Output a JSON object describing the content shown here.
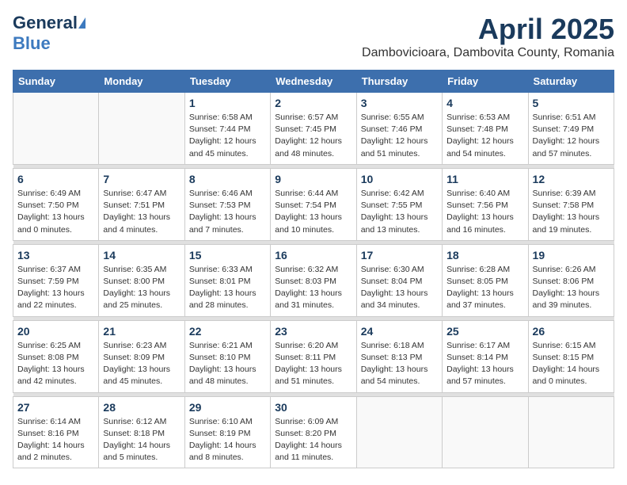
{
  "header": {
    "logo_general": "General",
    "logo_blue": "Blue",
    "month_title": "April 2025",
    "location": "Dambovicioara, Dambovita County, Romania"
  },
  "days_of_week": [
    "Sunday",
    "Monday",
    "Tuesday",
    "Wednesday",
    "Thursday",
    "Friday",
    "Saturday"
  ],
  "weeks": [
    [
      {
        "day": "",
        "detail": ""
      },
      {
        "day": "",
        "detail": ""
      },
      {
        "day": "1",
        "detail": "Sunrise: 6:58 AM\nSunset: 7:44 PM\nDaylight: 12 hours\nand 45 minutes."
      },
      {
        "day": "2",
        "detail": "Sunrise: 6:57 AM\nSunset: 7:45 PM\nDaylight: 12 hours\nand 48 minutes."
      },
      {
        "day": "3",
        "detail": "Sunrise: 6:55 AM\nSunset: 7:46 PM\nDaylight: 12 hours\nand 51 minutes."
      },
      {
        "day": "4",
        "detail": "Sunrise: 6:53 AM\nSunset: 7:48 PM\nDaylight: 12 hours\nand 54 minutes."
      },
      {
        "day": "5",
        "detail": "Sunrise: 6:51 AM\nSunset: 7:49 PM\nDaylight: 12 hours\nand 57 minutes."
      }
    ],
    [
      {
        "day": "6",
        "detail": "Sunrise: 6:49 AM\nSunset: 7:50 PM\nDaylight: 13 hours\nand 0 minutes."
      },
      {
        "day": "7",
        "detail": "Sunrise: 6:47 AM\nSunset: 7:51 PM\nDaylight: 13 hours\nand 4 minutes."
      },
      {
        "day": "8",
        "detail": "Sunrise: 6:46 AM\nSunset: 7:53 PM\nDaylight: 13 hours\nand 7 minutes."
      },
      {
        "day": "9",
        "detail": "Sunrise: 6:44 AM\nSunset: 7:54 PM\nDaylight: 13 hours\nand 10 minutes."
      },
      {
        "day": "10",
        "detail": "Sunrise: 6:42 AM\nSunset: 7:55 PM\nDaylight: 13 hours\nand 13 minutes."
      },
      {
        "day": "11",
        "detail": "Sunrise: 6:40 AM\nSunset: 7:56 PM\nDaylight: 13 hours\nand 16 minutes."
      },
      {
        "day": "12",
        "detail": "Sunrise: 6:39 AM\nSunset: 7:58 PM\nDaylight: 13 hours\nand 19 minutes."
      }
    ],
    [
      {
        "day": "13",
        "detail": "Sunrise: 6:37 AM\nSunset: 7:59 PM\nDaylight: 13 hours\nand 22 minutes."
      },
      {
        "day": "14",
        "detail": "Sunrise: 6:35 AM\nSunset: 8:00 PM\nDaylight: 13 hours\nand 25 minutes."
      },
      {
        "day": "15",
        "detail": "Sunrise: 6:33 AM\nSunset: 8:01 PM\nDaylight: 13 hours\nand 28 minutes."
      },
      {
        "day": "16",
        "detail": "Sunrise: 6:32 AM\nSunset: 8:03 PM\nDaylight: 13 hours\nand 31 minutes."
      },
      {
        "day": "17",
        "detail": "Sunrise: 6:30 AM\nSunset: 8:04 PM\nDaylight: 13 hours\nand 34 minutes."
      },
      {
        "day": "18",
        "detail": "Sunrise: 6:28 AM\nSunset: 8:05 PM\nDaylight: 13 hours\nand 37 minutes."
      },
      {
        "day": "19",
        "detail": "Sunrise: 6:26 AM\nSunset: 8:06 PM\nDaylight: 13 hours\nand 39 minutes."
      }
    ],
    [
      {
        "day": "20",
        "detail": "Sunrise: 6:25 AM\nSunset: 8:08 PM\nDaylight: 13 hours\nand 42 minutes."
      },
      {
        "day": "21",
        "detail": "Sunrise: 6:23 AM\nSunset: 8:09 PM\nDaylight: 13 hours\nand 45 minutes."
      },
      {
        "day": "22",
        "detail": "Sunrise: 6:21 AM\nSunset: 8:10 PM\nDaylight: 13 hours\nand 48 minutes."
      },
      {
        "day": "23",
        "detail": "Sunrise: 6:20 AM\nSunset: 8:11 PM\nDaylight: 13 hours\nand 51 minutes."
      },
      {
        "day": "24",
        "detail": "Sunrise: 6:18 AM\nSunset: 8:13 PM\nDaylight: 13 hours\nand 54 minutes."
      },
      {
        "day": "25",
        "detail": "Sunrise: 6:17 AM\nSunset: 8:14 PM\nDaylight: 13 hours\nand 57 minutes."
      },
      {
        "day": "26",
        "detail": "Sunrise: 6:15 AM\nSunset: 8:15 PM\nDaylight: 14 hours\nand 0 minutes."
      }
    ],
    [
      {
        "day": "27",
        "detail": "Sunrise: 6:14 AM\nSunset: 8:16 PM\nDaylight: 14 hours\nand 2 minutes."
      },
      {
        "day": "28",
        "detail": "Sunrise: 6:12 AM\nSunset: 8:18 PM\nDaylight: 14 hours\nand 5 minutes."
      },
      {
        "day": "29",
        "detail": "Sunrise: 6:10 AM\nSunset: 8:19 PM\nDaylight: 14 hours\nand 8 minutes."
      },
      {
        "day": "30",
        "detail": "Sunrise: 6:09 AM\nSunset: 8:20 PM\nDaylight: 14 hours\nand 11 minutes."
      },
      {
        "day": "",
        "detail": ""
      },
      {
        "day": "",
        "detail": ""
      },
      {
        "day": "",
        "detail": ""
      }
    ]
  ]
}
